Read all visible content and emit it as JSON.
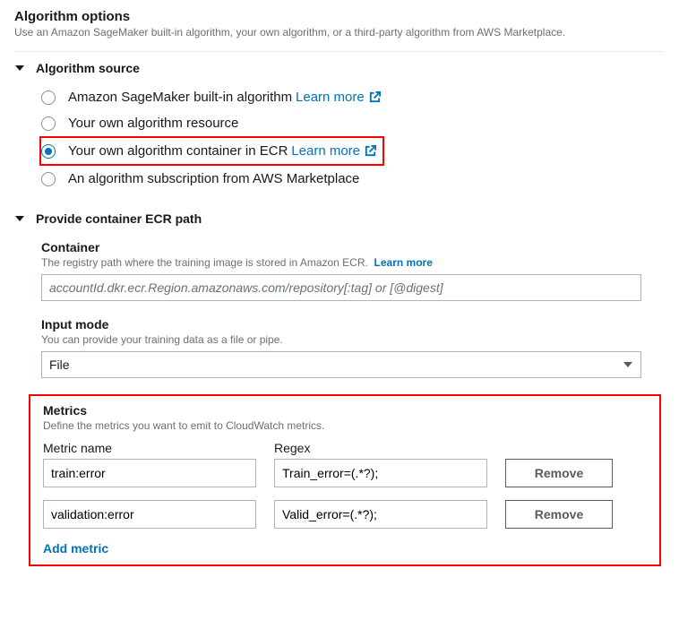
{
  "header": {
    "title": "Algorithm options",
    "subtitle": "Use an Amazon SageMaker built-in algorithm, your own algorithm, or a third-party algorithm from AWS Marketplace."
  },
  "source": {
    "title": "Algorithm source",
    "options": [
      {
        "label": "Amazon SageMaker built-in algorithm",
        "learn": "Learn more",
        "ext": true,
        "selected": false
      },
      {
        "label": "Your own algorithm resource",
        "learn": null,
        "ext": false,
        "selected": false
      },
      {
        "label": "Your own algorithm container in ECR",
        "learn": "Learn more",
        "ext": true,
        "selected": true
      },
      {
        "label": "An algorithm subscription from AWS Marketplace",
        "learn": null,
        "ext": false,
        "selected": false
      }
    ]
  },
  "ecr": {
    "title": "Provide container ECR path",
    "container": {
      "label": "Container",
      "desc": "The registry path where the training image is stored in Amazon ECR.",
      "learn": "Learn more",
      "placeholder": "accountId.dkr.ecr.Region.amazonaws.com/repository[:tag] or [@digest]"
    },
    "input_mode": {
      "label": "Input mode",
      "desc": "You can provide your training data as a file or pipe.",
      "value": "File"
    },
    "metrics": {
      "label": "Metrics",
      "desc": "Define the metrics you want to emit to CloudWatch metrics.",
      "headers": {
        "name": "Metric name",
        "regex": "Regex"
      },
      "rows": [
        {
          "name": "train:error",
          "regex": "Train_error=(.*?);",
          "remove": "Remove"
        },
        {
          "name": "validation:error",
          "regex": "Valid_error=(.*?);",
          "remove": "Remove"
        }
      ],
      "add": "Add metric"
    }
  }
}
